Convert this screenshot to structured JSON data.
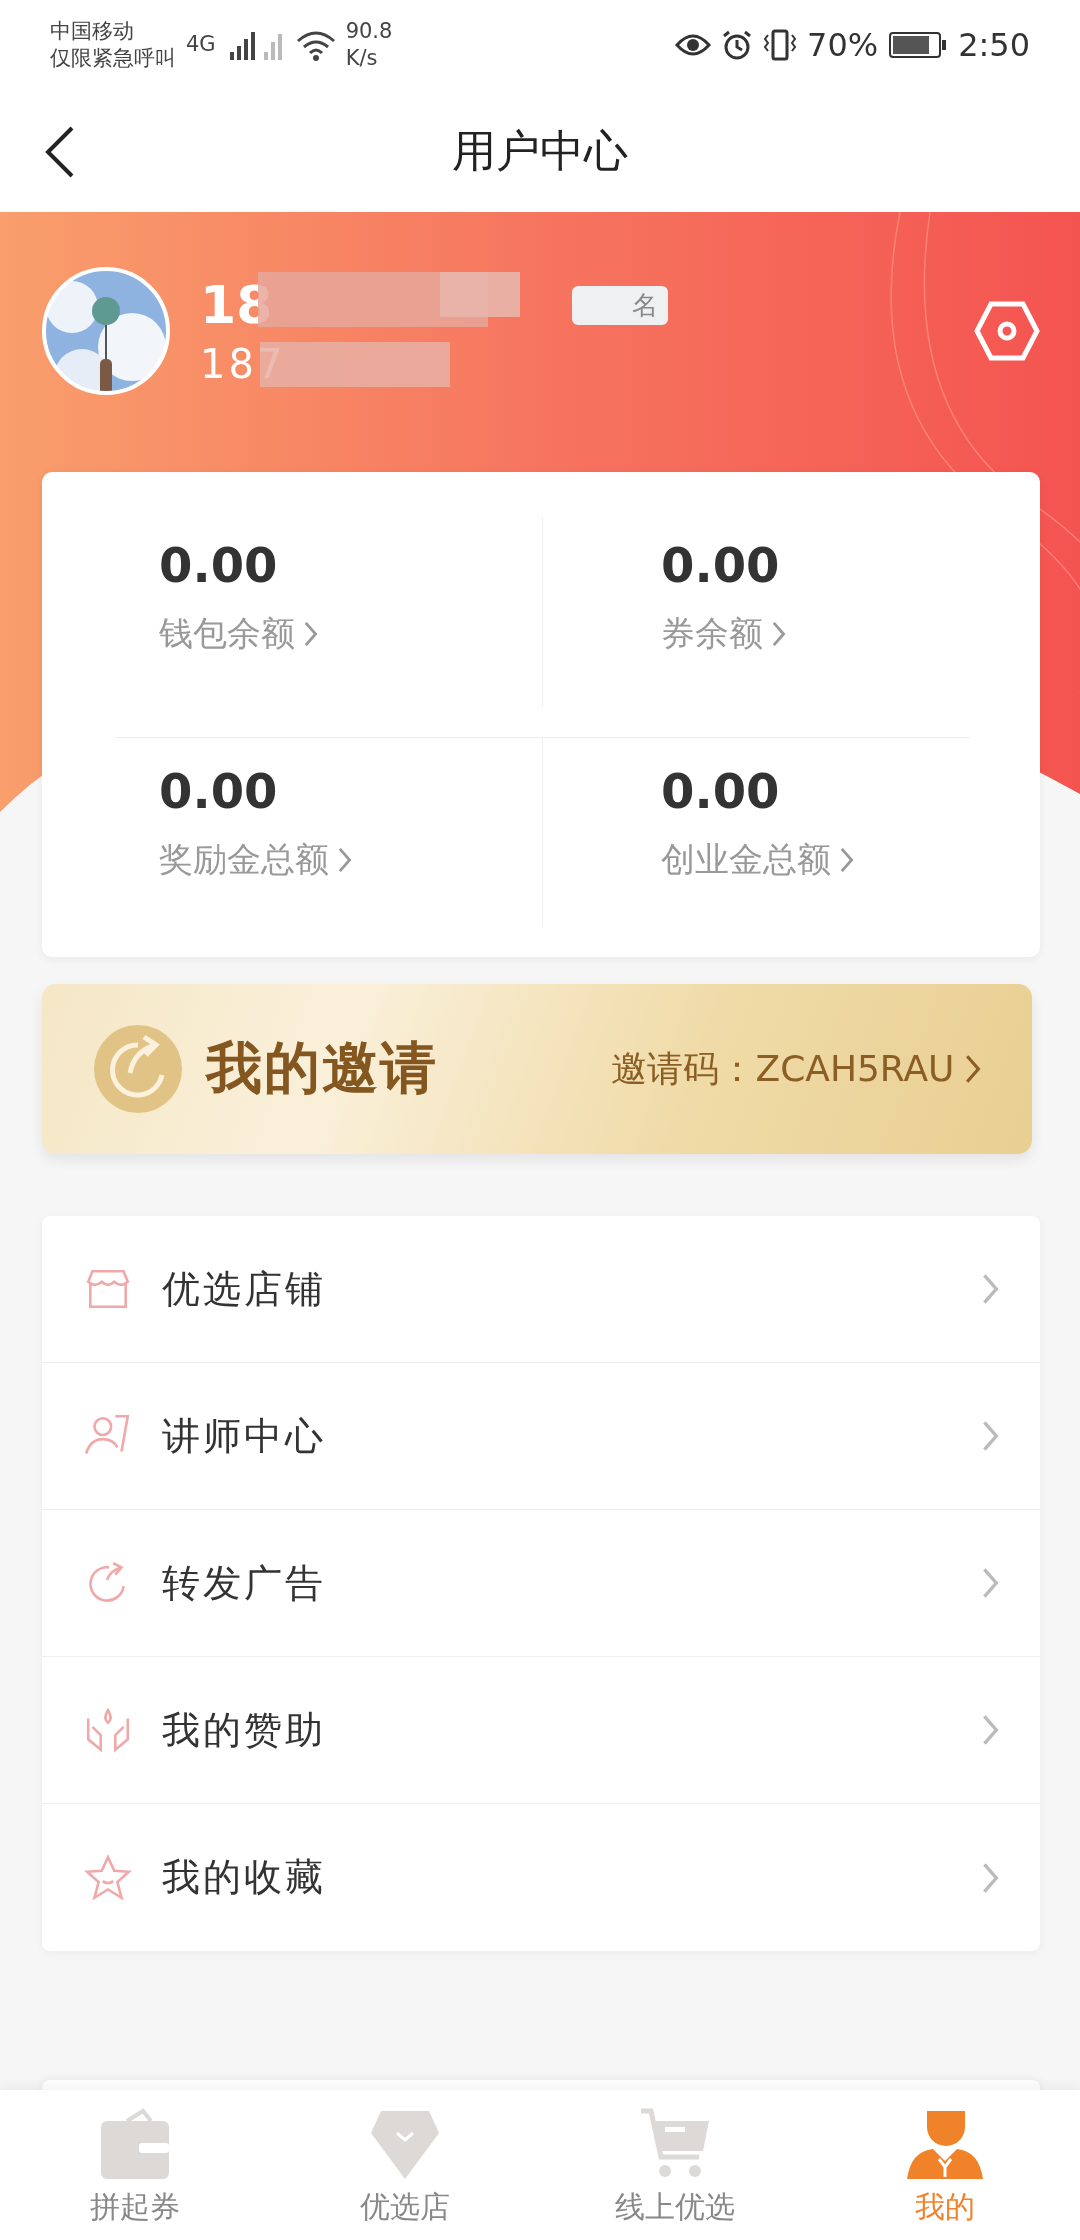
{
  "status_bar": {
    "carrier": "中国移动",
    "carrier_note": "仅限紧急呼叫",
    "network": "4G",
    "speed": "90.8",
    "speed_unit": "K/s",
    "battery": "70%",
    "time": "2:50"
  },
  "nav": {
    "title": "用户中心"
  },
  "profile": {
    "name": "18",
    "phone": "187",
    "badge": "名"
  },
  "balances": [
    {
      "value": "0.00",
      "label": "钱包余额"
    },
    {
      "value": "0.00",
      "label": "券余额"
    },
    {
      "value": "0.00",
      "label": "奖励金总额"
    },
    {
      "value": "0.00",
      "label": "创业金总额"
    }
  ],
  "invite": {
    "title": "我的邀请",
    "code_label": "邀请码：ZCAH5RAU"
  },
  "menu": [
    {
      "kind": "store",
      "label": "优选店铺"
    },
    {
      "kind": "teacher",
      "label": "讲师中心"
    },
    {
      "kind": "share",
      "label": "转发广告"
    },
    {
      "kind": "sponsor",
      "label": "我的赞助"
    },
    {
      "kind": "favorite",
      "label": "我的收藏"
    }
  ],
  "tabs": [
    {
      "kind": "wallet",
      "label": "拼起券",
      "selected": false
    },
    {
      "kind": "diamond",
      "label": "优选店",
      "selected": false
    },
    {
      "kind": "cart",
      "label": "线上优选",
      "selected": false
    },
    {
      "kind": "user",
      "label": "我的",
      "selected": true
    }
  ]
}
